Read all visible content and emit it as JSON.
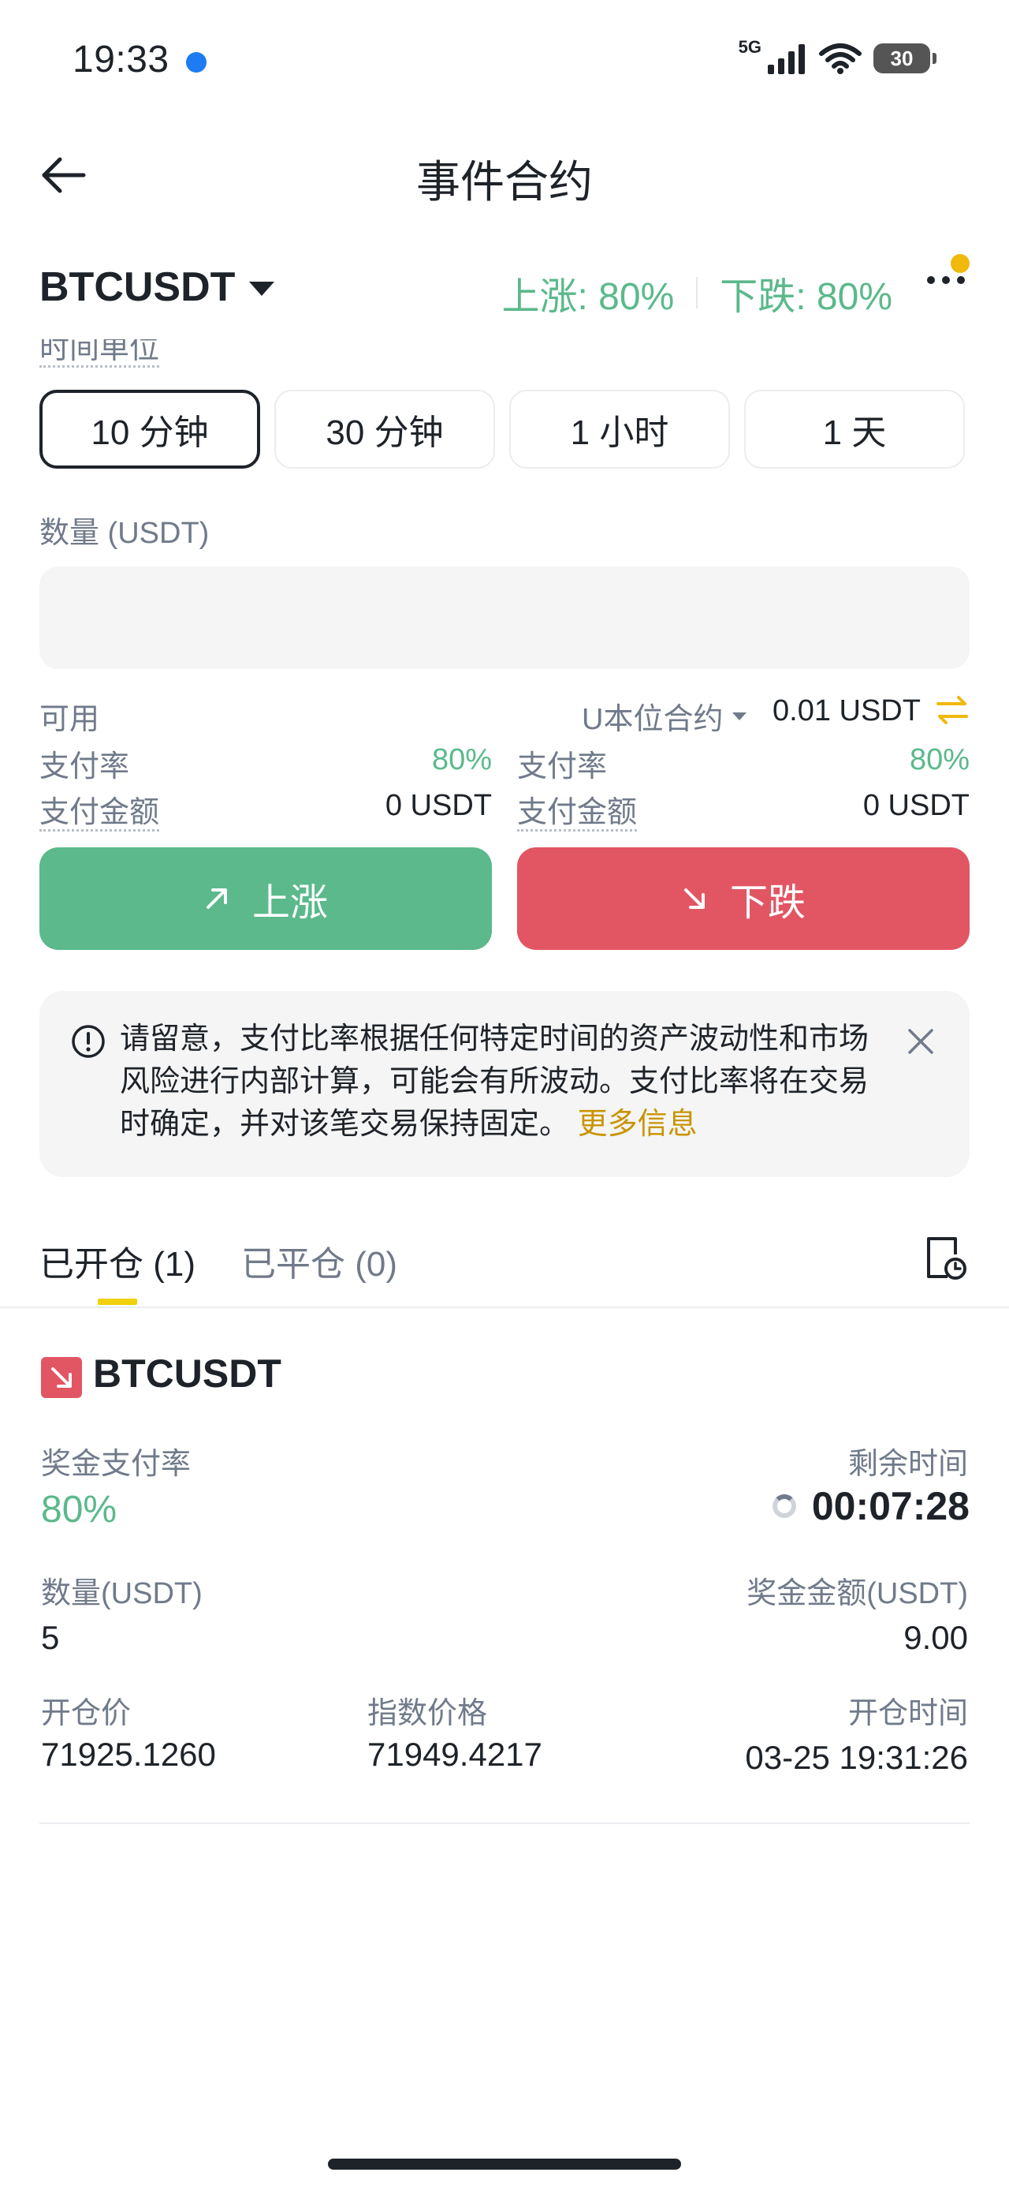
{
  "status_bar": {
    "time": "19:33",
    "network": "5G",
    "battery": "30"
  },
  "header": {
    "title": "事件合约"
  },
  "symbol_bar": {
    "pair": "BTCUSDT",
    "up_ratio": "上涨: 80%",
    "down_ratio": "下跌: 80%"
  },
  "order_form": {
    "time_unit_label": "时间单位",
    "time_options": [
      "10 分钟",
      "30 分钟",
      "1 小时",
      "1 天"
    ],
    "selected_time": "10 分钟",
    "quantity_label": "数量 (USDT)",
    "quantity_value": "",
    "available_label": "可用",
    "contract_type": "U本位合约",
    "available_value": "0.01 USDT",
    "up_side": {
      "payout_rate_label": "支付率",
      "payout_rate": "80%",
      "payout_amount_label": "支付金额",
      "payout_amount": "0 USDT"
    },
    "down_side": {
      "payout_rate_label": "支付率",
      "payout_rate": "80%",
      "payout_amount_label": "支付金额",
      "payout_amount": "0 USDT"
    },
    "up_button": "上涨",
    "down_button": "下跌"
  },
  "notice": {
    "text": "请留意，支付比率根据任何特定时间的资产波动性和市场风险进行内部计算，可能会有所波动。支付比率将在交易时确定，并对该笔交易保持固定。",
    "link": "更多信息"
  },
  "positions": {
    "tab_open": "已开仓 (1)",
    "tab_closed": "已平仓 (0)",
    "item": {
      "symbol": "BTCUSDT",
      "payout_rate_label": "奖金支付率",
      "payout_rate": "80%",
      "remaining_label": "剩余时间",
      "remaining": "00:07:28",
      "qty_label": "数量(USDT)",
      "qty": "5",
      "bonus_label": "奖金金额(USDT)",
      "bonus": "9.00",
      "open_price_label": "开仓价",
      "open_price": "71925.1260",
      "index_price_label": "指数价格",
      "index_price": "71949.4217",
      "open_time_label": "开仓时间",
      "open_time": "03-25 19:31:26"
    }
  },
  "colors": {
    "up": "#5bb98b",
    "down": "#e25563",
    "accent": "#f0b90b",
    "link": "#c99400"
  }
}
